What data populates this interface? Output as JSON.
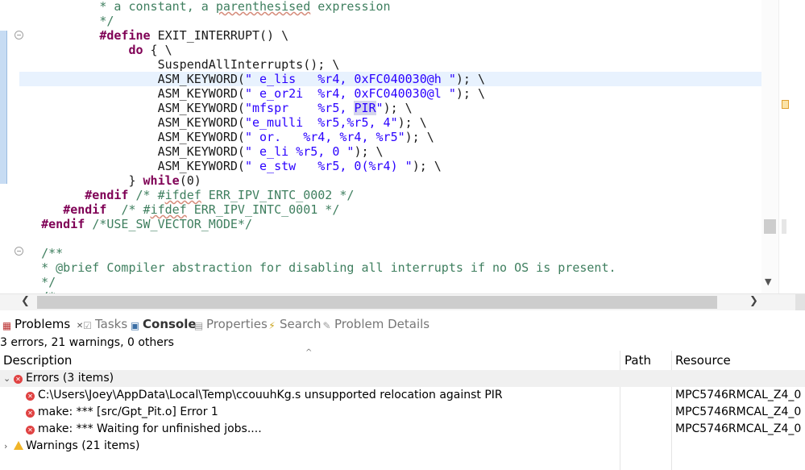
{
  "editor": {
    "lines": [
      {
        "html": "           <span class=\"cm\">* a constant, a <span class=\"sq\">parenthesised</span> expression</span>"
      },
      {
        "html": "           <span class=\"cm\">*/</span>"
      },
      {
        "html": "           <span class=\"kw\">#define</span> EXIT_INTERRUPT() \\"
      },
      {
        "html": "               <span class=\"kw\">do</span> { \\"
      },
      {
        "html": "                   SuspendAllInterrupts(); \\"
      },
      {
        "html": "                   ASM_KEYWORD(<span class=\"str\">\" e_lis   %r4, 0xFC040030@h \"</span>); \\"
      },
      {
        "html": "                   ASM_KEYWORD(<span class=\"str\">\" e_or2i  %r4, 0xFC040030@l \"</span>); \\"
      },
      {
        "html": "                   ASM_KEYWORD(<span class=\"str\">\"mfspr    %r5, <span class=\"hl\">PIR</span>\"</span>); \\"
      },
      {
        "html": "                   ASM_KEYWORD(<span class=\"str\">\"e_mulli  %r5,%r5, 4\"</span>); \\"
      },
      {
        "html": "                   ASM_KEYWORD(<span class=\"str\">\" or.   %r4, %r4, %r5\"</span>); \\"
      },
      {
        "html": "                   ASM_KEYWORD(<span class=\"str\">\" e_li %r5, 0 \"</span>); \\"
      },
      {
        "html": "                   ASM_KEYWORD(<span class=\"str\">\" e_stw   %r5, 0(%r4) \"</span>); \\"
      },
      {
        "html": "               } <span class=\"kw\">while</span>(0)"
      },
      {
        "html": "         <span class=\"kw\">#endif</span> <span class=\"cm\">/* #<span class=\"sq\">ifdef</span> ERR_IPV_INTC_0002 */</span>"
      },
      {
        "html": "      <span class=\"kw\">#endif</span>  <span class=\"cm\">/* #<span class=\"sq\">ifdef</span> ERR_IPV_INTC_0001 */</span>"
      },
      {
        "html": "   <span class=\"kw\">#endif</span> <span class=\"cm\">/*USE_SW_VECTOR_MODE*/</span>"
      },
      {
        "html": ""
      },
      {
        "html": "   <span class=\"cm\">/**</span>"
      },
      {
        "html": "   <span class=\"cm\">* @brief Compiler abstraction for disabling all interrupts if no OS is present.</span>"
      },
      {
        "html": "   <span class=\"cm\">*/</span>"
      },
      {
        "html": "   <span class=\"cm\">/*</span>"
      }
    ],
    "current_line": 5
  },
  "tabs": [
    {
      "label": "Problems",
      "icon": "problems-icon",
      "glyph": "▦",
      "active": true,
      "close": "✕"
    },
    {
      "label": "Tasks",
      "icon": "tasks-icon",
      "glyph": "☑"
    },
    {
      "label": "Console",
      "icon": "console-icon",
      "glyph": "▣",
      "bold": true
    },
    {
      "label": "Properties",
      "icon": "properties-icon",
      "glyph": "▤"
    },
    {
      "label": "Search",
      "icon": "search-icon",
      "glyph": "⚡"
    },
    {
      "label": "Problem Details",
      "icon": "problem-details-icon",
      "glyph": "✎"
    }
  ],
  "problems": {
    "summary": "3 errors, 21 warnings, 0 others",
    "columns": {
      "description": "Description",
      "path": "Path",
      "resource": "Resource"
    },
    "errors_group": "Errors (3 items)",
    "errors": [
      {
        "description": "C:\\Users\\Joey\\AppData\\Local\\Temp\\ccouuhKg.s unsupported relocation against PIR",
        "path": "",
        "resource": "MPC5746RMCAL_Z4_0"
      },
      {
        "description": "make: *** [src/Gpt_Pit.o] Error 1",
        "path": "",
        "resource": "MPC5746RMCAL_Z4_0"
      },
      {
        "description": "make: *** Waiting for unfinished jobs....",
        "path": "",
        "resource": "MPC5746RMCAL_Z4_0"
      }
    ],
    "warnings_group": "Warnings (21 items)"
  },
  "colors": {
    "keyword": "#7f0055",
    "comment": "#3f7f5f",
    "string": "#2a00ff",
    "current_line": "#e8f2fe",
    "error": "#e04242",
    "warning": "#f0b428"
  }
}
